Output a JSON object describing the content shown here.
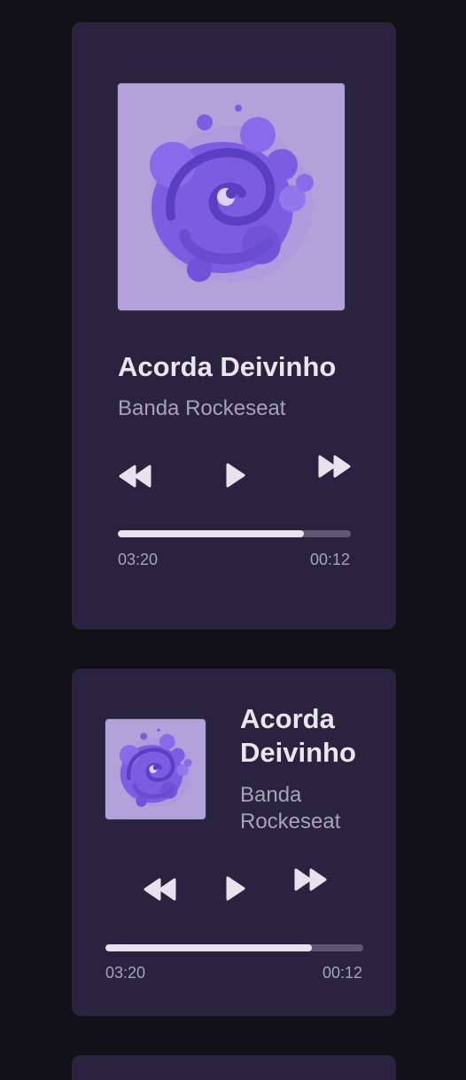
{
  "colors": {
    "background": "#121117",
    "card": "#2A2340",
    "art_background": "#B3A1D9",
    "art_primary": "#7C5CE0",
    "text_primary": "#E9E6F2",
    "text_secondary": "#A7A3B6",
    "progress_track": "#5E5871",
    "progress_fill": "#E7E4EE"
  },
  "players": [
    {
      "title": "Acorda Deivinho",
      "artist": "Banda Rockeseat",
      "elapsed": "03:20",
      "remaining": "00:12",
      "progress": 0.8,
      "controls": {
        "rewind_icon": "rewind-icon",
        "play_icon": "play-icon",
        "forward_icon": "fast-forward-icon"
      }
    },
    {
      "title_lines": [
        "Acorda",
        "Deivinho"
      ],
      "artist_lines": [
        "Banda",
        "Rockeseat"
      ],
      "elapsed": "03:20",
      "remaining": "00:12",
      "progress": 0.8,
      "controls": {
        "rewind_icon": "rewind-icon",
        "play_icon": "play-icon",
        "forward_icon": "fast-forward-icon"
      }
    }
  ]
}
